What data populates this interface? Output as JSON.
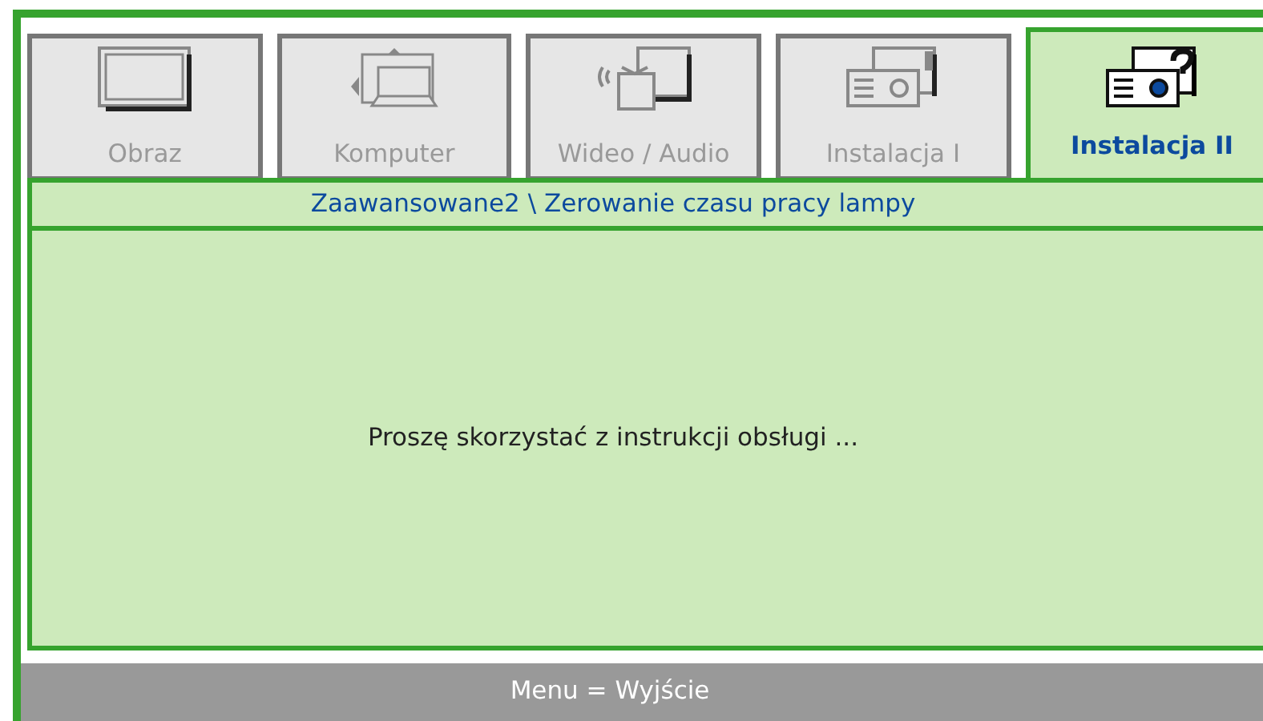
{
  "tabs": [
    {
      "label": "Obraz",
      "selected": false
    },
    {
      "label": "Komputer",
      "selected": false
    },
    {
      "label": "Wideo / Audio",
      "selected": false
    },
    {
      "label": "Instalacja I",
      "selected": false
    },
    {
      "label": "Instalacja II",
      "selected": true
    }
  ],
  "breadcrumb": "Zaawansowane2 \\ Zerowanie czasu pracy lampy",
  "message": "Proszę skorzystać z instrukcji obsługi ...",
  "status_bar": "Menu = Wyjście"
}
